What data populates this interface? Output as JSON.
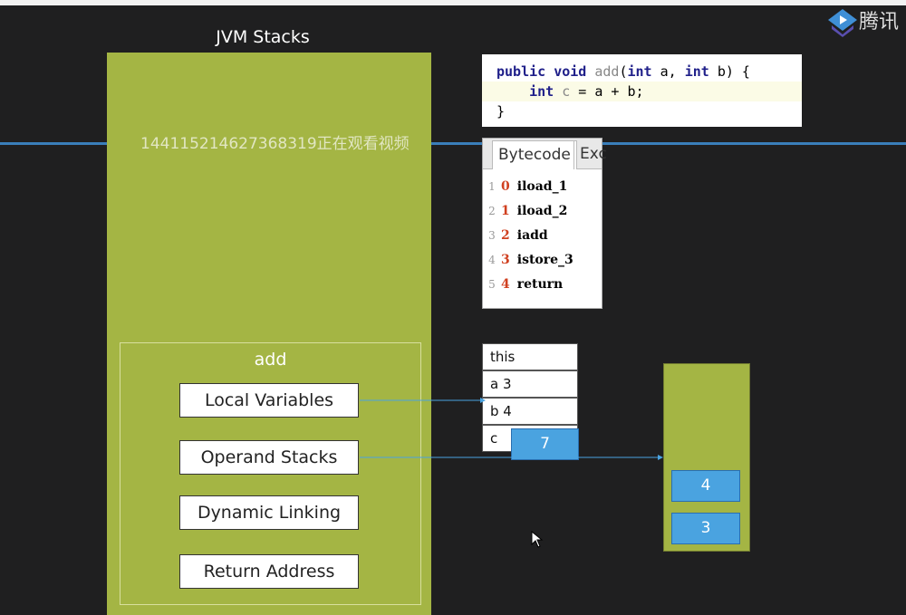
{
  "brand": {
    "logo_text": "腾讯",
    "accent": "#4aa3e0"
  },
  "jvm": {
    "title": "JVM Stacks",
    "watermark": "144115214627368319正在观看视频",
    "frame": {
      "title": "add",
      "buttons": [
        "Local Variables",
        "Operand Stacks",
        "Dynamic Linking",
        "Return Address"
      ]
    }
  },
  "code": {
    "l1_kw1": "public void ",
    "l1_name": "add",
    "l1_rest1": "(",
    "l1_kw2": "int",
    " l1_a": "",
    "l1_a2": " a, ",
    "l1_kw3": "int",
    "l1_b": " b) {",
    "l2_kw": "int",
    "l2_c": " c",
    "l2_rest": " = a + b;",
    "l3": "}"
  },
  "bytecode": {
    "tabs": [
      "Bytecode",
      "Exc"
    ],
    "lines": [
      {
        "n": "1",
        "off": "0",
        "op": "iload_1"
      },
      {
        "n": "2",
        "off": "1",
        "op": "iload_2"
      },
      {
        "n": "3",
        "off": "2",
        "op": "iadd"
      },
      {
        "n": "4",
        "off": "3",
        "op": "istore_3"
      },
      {
        "n": "5",
        "off": "4",
        "op": "return"
      }
    ]
  },
  "local_vars": [
    "this",
    "a 3",
    "b 4",
    "c"
  ],
  "result_value": "7",
  "operand_stack": [
    "4",
    "3"
  ]
}
